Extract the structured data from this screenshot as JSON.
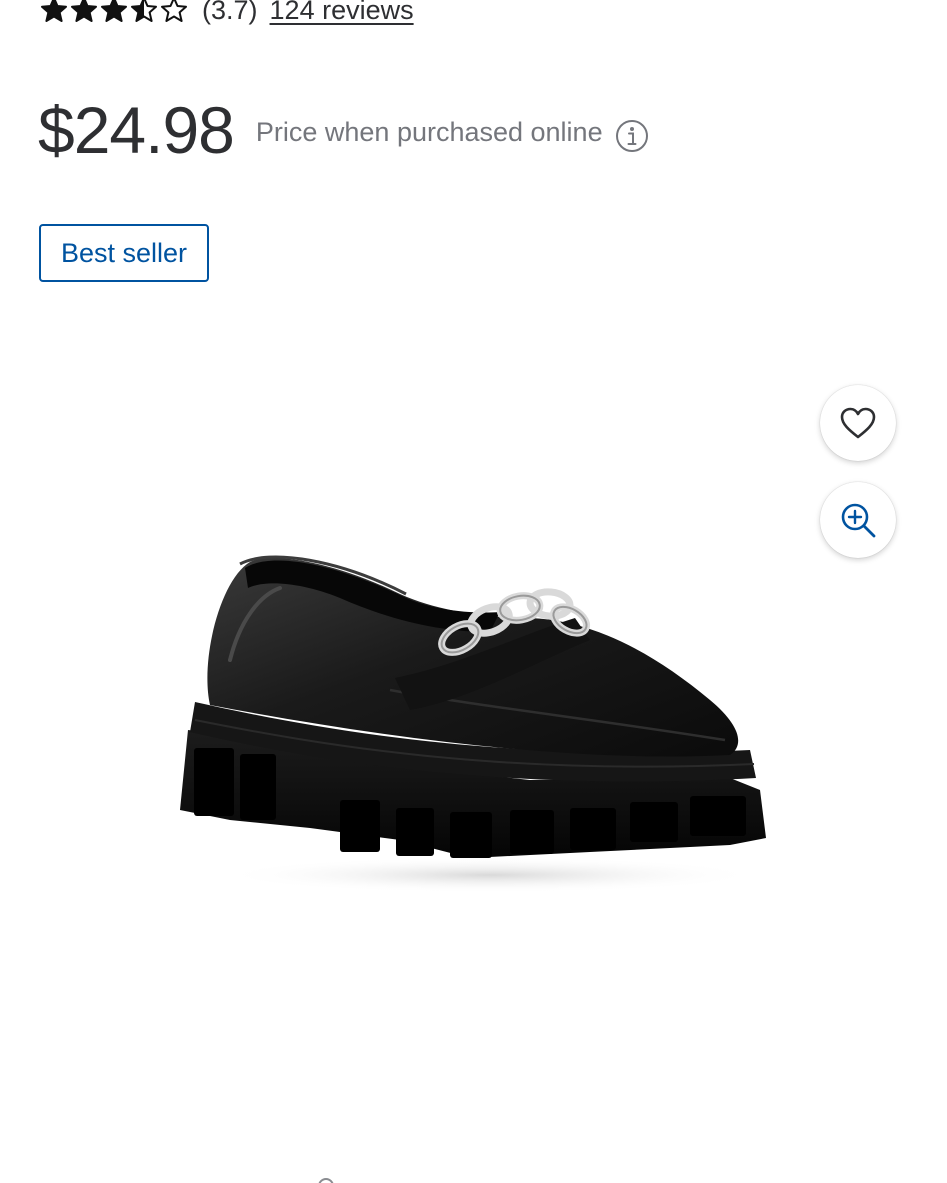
{
  "rating": {
    "stars_value": 3.7,
    "display": "(3.7)",
    "reviews_label": "124 reviews"
  },
  "price": {
    "amount": "$24.98",
    "note": "Price when purchased online"
  },
  "badge": {
    "label": "Best seller"
  },
  "actions": {
    "favorite_icon": "heart-icon",
    "zoom_icon": "zoom-in-icon"
  },
  "product_image": {
    "subject": "black chunky lug-sole loafer with silver chain"
  },
  "colors": {
    "text_primary": "#2e2f32",
    "text_secondary": "#74767c",
    "brand_blue": "#0053a0"
  }
}
